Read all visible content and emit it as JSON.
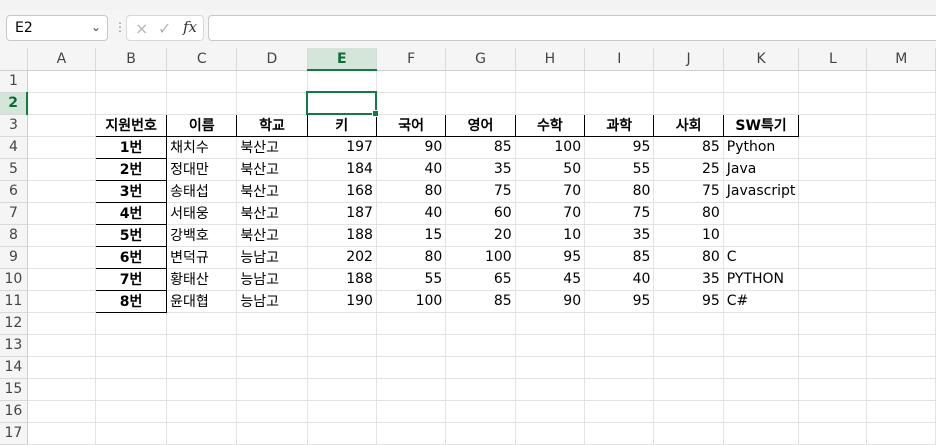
{
  "namebox": {
    "value": "E2"
  },
  "formula_bar": {
    "fx_label": "fx",
    "cancel_icon": "×",
    "enter_icon": "✓",
    "content": ""
  },
  "columns": [
    "A",
    "B",
    "C",
    "D",
    "E",
    "F",
    "G",
    "H",
    "I",
    "J",
    "K",
    "L",
    "M"
  ],
  "rows": [
    "1",
    "2",
    "3",
    "4",
    "5",
    "6",
    "7",
    "8",
    "9",
    "10",
    "11",
    "12",
    "13",
    "14",
    "15",
    "16",
    "17"
  ],
  "selection": {
    "column": "E",
    "row": "2"
  },
  "table": {
    "headers": [
      "지원번호",
      "이름",
      "학교",
      "키",
      "국어",
      "영어",
      "수학",
      "과학",
      "사회",
      "SW특기"
    ],
    "records": [
      [
        "1번",
        "채치수",
        "북산고",
        "197",
        "90",
        "85",
        "100",
        "95",
        "85",
        "Python"
      ],
      [
        "2번",
        "정대만",
        "북산고",
        "184",
        "40",
        "35",
        "50",
        "55",
        "25",
        "Java"
      ],
      [
        "3번",
        "송태섭",
        "북산고",
        "168",
        "80",
        "75",
        "70",
        "80",
        "75",
        "Javascript"
      ],
      [
        "4번",
        "서태웅",
        "북산고",
        "187",
        "40",
        "60",
        "70",
        "75",
        "80",
        ""
      ],
      [
        "5번",
        "강백호",
        "북산고",
        "188",
        "15",
        "20",
        "10",
        "35",
        "10",
        ""
      ],
      [
        "6번",
        "변덕규",
        "능남고",
        "202",
        "80",
        "100",
        "95",
        "85",
        "80",
        "C"
      ],
      [
        "7번",
        "황태산",
        "능남고",
        "188",
        "55",
        "65",
        "45",
        "40",
        "35",
        "PYTHON"
      ],
      [
        "8번",
        "윤대협",
        "능남고",
        "190",
        "100",
        "85",
        "90",
        "95",
        "95",
        "C#"
      ]
    ]
  },
  "colors": {
    "accent": "#107c41",
    "header_bg": "#f5f5f5",
    "selected_header_bg": "#d3e6d9",
    "gridline": "#e3e3e3"
  }
}
